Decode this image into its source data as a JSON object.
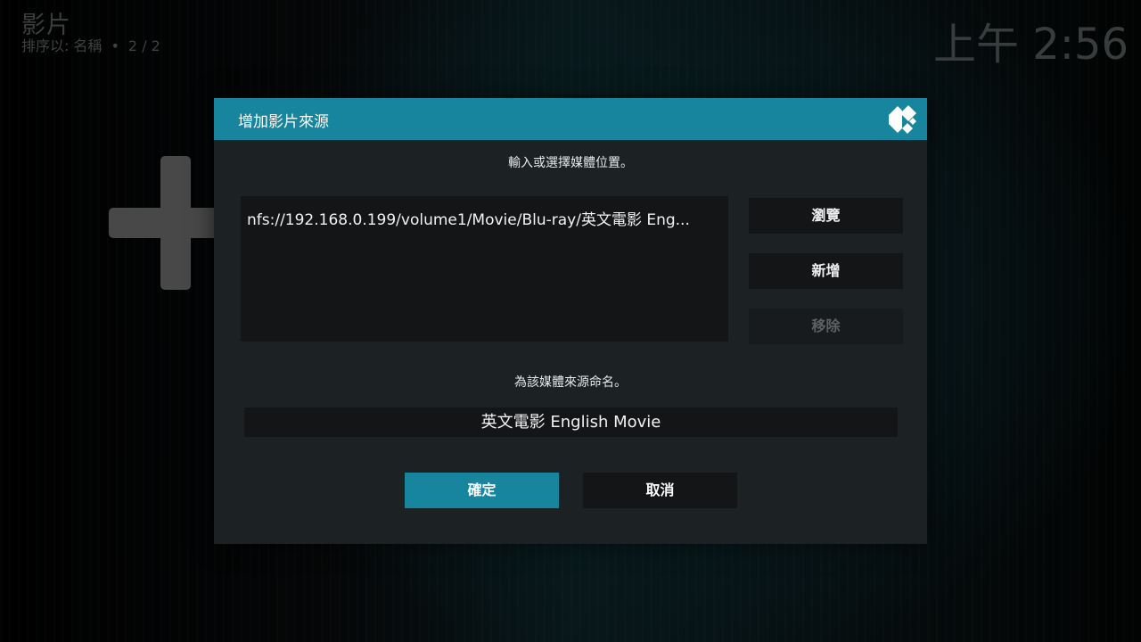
{
  "header": {
    "title": "影片",
    "sort_label": "排序以: 名稱",
    "separator": "•",
    "page": "2 / 2"
  },
  "clock": "上午 2:56",
  "background": {
    "add_tile_icon": "plus-icon"
  },
  "dialog": {
    "title": "增加影片來源",
    "logo_icon": "kodi-logo-icon",
    "path_prompt": "輸入或選擇媒體位置。",
    "paths": [
      "nfs://192.168.0.199/volume1/Movie/Blu-ray/英文電影 Eng..."
    ],
    "buttons": {
      "browse": "瀏覽",
      "add": "新增",
      "remove": "移除"
    },
    "name_prompt": "為該媒體來源命名。",
    "name_value": "英文電影 English Movie",
    "ok": "確定",
    "cancel": "取消"
  },
  "colors": {
    "accent": "#17859d",
    "dialog_bg": "#1c2224",
    "field_bg": "#131517",
    "disabled_text": "#5e6163"
  }
}
